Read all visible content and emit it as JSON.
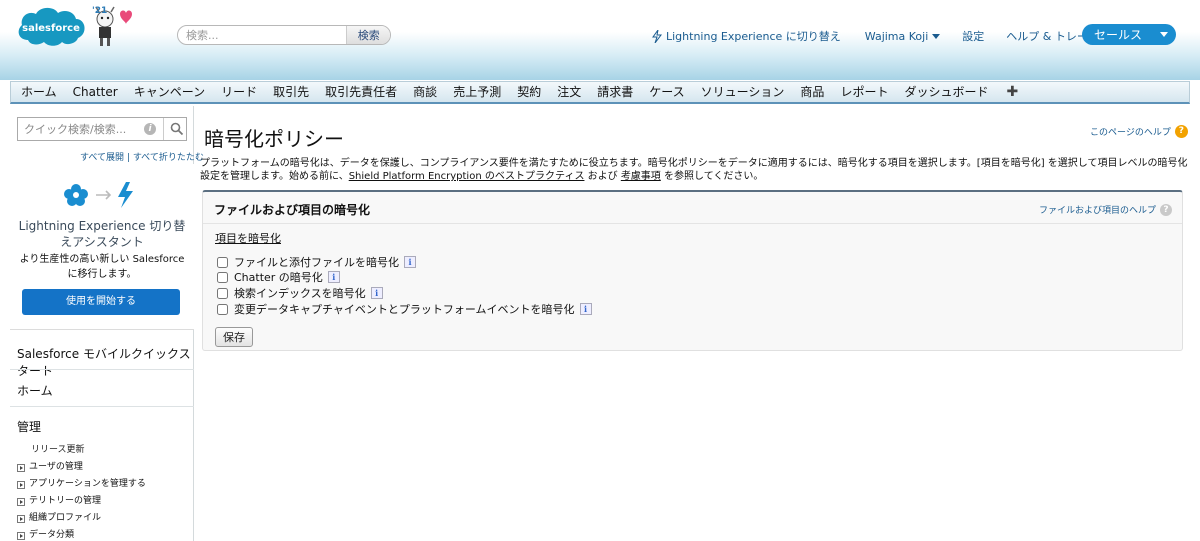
{
  "header": {
    "brand": "salesforce",
    "year_badge": "'21",
    "search_placeholder": "検索...",
    "search_button": "検索",
    "lightning_link": "Lightning Experience に切り替え",
    "user_name": "Wajima Koji",
    "settings_link": "設定",
    "help_link": "ヘルプ & トレーニング",
    "app_switcher": "セールス"
  },
  "tabs": [
    "ホーム",
    "Chatter",
    "キャンペーン",
    "リード",
    "取引先",
    "取引先責任者",
    "商談",
    "売上予測",
    "契約",
    "注文",
    "請求書",
    "ケース",
    "ソリューション",
    "商品",
    "レポート",
    "ダッシュボード"
  ],
  "tab_plus": "✚",
  "sidebar": {
    "quick_search_placeholder": "クイック検索/検索...",
    "info_icon": "i",
    "expand_all": "すべて展開",
    "separator": "|",
    "collapse_all": "すべて折りたたむ",
    "le_title": "Lightning Experience 切り替えアシスタント",
    "le_subtitle": "より生産性の高い新しい Salesforce に移行します。",
    "le_button": "使用を開始する",
    "mobile_quickstart": "Salesforce モバイルクイックスタート",
    "home": "ホーム",
    "admin": "管理",
    "release_update": "リリース更新",
    "tree_items": [
      "ユーザの管理",
      "アプリケーションを管理する",
      "テリトリーの管理",
      "組織プロファイル",
      "データ分類"
    ]
  },
  "main": {
    "title": "暗号化ポリシー",
    "page_help": "このページのヘルプ",
    "desc_1": "プラットフォームの暗号化は、データを保護し、コンプライアンス要件を満たすために役立ちます。暗号化ポリシーをデータに適用するには、暗号化する項目を選択します。[項目を暗号化] を選択して項目レベルの暗号化設定を管理します。始める前に、",
    "desc_link_1": "Shield Platform Encryption のベストプラクティス",
    "desc_2": " および ",
    "desc_link_2": "考慮事項",
    "desc_3": " を参照してください。",
    "panel_title": "ファイルおよび項目の暗号化",
    "panel_help": "ファイルおよび項目のヘルプ",
    "encrypt_fields": "項目を暗号化",
    "options": [
      {
        "label": "ファイルと添付ファイルを暗号化",
        "checked": false
      },
      {
        "label": "Chatter の暗号化",
        "checked": false
      },
      {
        "label": "検索インデックスを暗号化",
        "checked": false
      },
      {
        "label": "変更データキャプチャイベントとプラットフォームイベントを暗号化",
        "checked": false
      }
    ],
    "info_badge": "i",
    "help_q": "?",
    "save_button": "保存"
  },
  "colors": {
    "brand_blue": "#1a8dd0",
    "link": "#1a5b8f",
    "le_button": "#1473c7",
    "help_orange": "#f2a200"
  }
}
